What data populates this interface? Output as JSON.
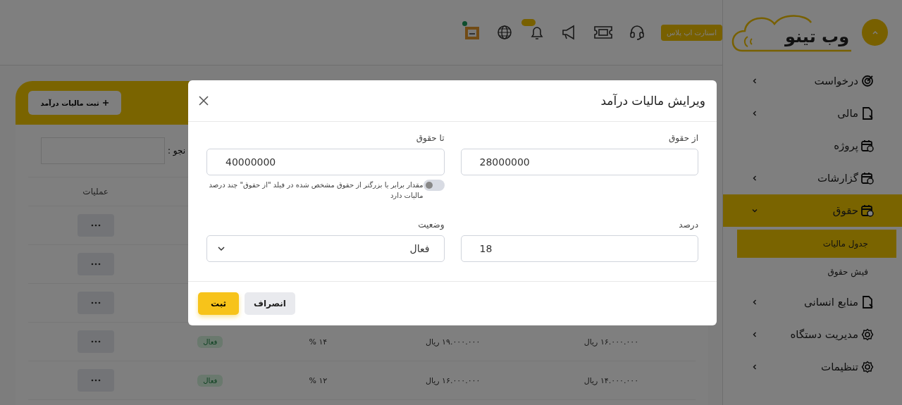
{
  "header": {
    "upgrade_button": "استارت اپ پلاس",
    "notification_badge": true,
    "profile_online": true
  },
  "sidebar": {
    "logo": "وب تینو",
    "items": [
      {
        "label": "درخواست",
        "has_children": true,
        "expanded": false,
        "selected": false
      },
      {
        "label": "مالی",
        "has_children": true,
        "expanded": false,
        "selected": false
      },
      {
        "label": "پروژه",
        "has_children": false,
        "selected": false
      },
      {
        "label": "گزارشات",
        "has_children": true,
        "expanded": false,
        "selected": false
      },
      {
        "label": "حقوق",
        "has_children": true,
        "expanded": true,
        "selected": true,
        "children": [
          {
            "label": "جدول مالیات",
            "selected": true
          },
          {
            "label": "فیش حقوق",
            "selected": false
          }
        ]
      },
      {
        "label": "منابع انسانی",
        "has_children": true,
        "expanded": false,
        "selected": false
      },
      {
        "label": "مدیریت دستگاه",
        "has_children": true,
        "expanded": false,
        "selected": false
      },
      {
        "label": "تنظیمات",
        "has_children": true,
        "expanded": false,
        "selected": false
      }
    ]
  },
  "page": {
    "add_button": "ثبت مالیات درآمد",
    "search_label": "نجو :",
    "table": {
      "columns": [
        "عملیات"
      ],
      "rows": [
        {},
        {},
        {},
        {
          "from_salary": "۱۶.۰۰۰.۰۰۰ ریال",
          "to_salary": "۱۹.۰۰۰.۰۰۰ ریال",
          "percent": "۱۴ %",
          "status": "فعال"
        },
        {
          "from_salary": "۱۴.۰۰۰.۰۰۰ ریال",
          "to_salary": "۱۶.۰۰۰.۰۰۰ ریال",
          "percent": "۱۲ %",
          "status": "فعال"
        }
      ]
    }
  },
  "modal": {
    "title": "ویرایش مالیات درآمد",
    "fields": [
      {
        "label": "از حقوق",
        "value": "28000000",
        "kind": "text"
      },
      {
        "label": "تا حقوق",
        "value": "40000000",
        "kind": "text",
        "toggle": {
          "on": false,
          "help": "مقدار برابر یا بزرگتر از حقوق مشخص شده در فیلد \"از حقوق\" چند درصد مالیات دارد"
        }
      },
      {
        "label": "درصد",
        "value": "18",
        "kind": "text"
      },
      {
        "label": "وضعیت",
        "value": "فعال",
        "kind": "select"
      }
    ],
    "buttons": [
      {
        "label": "انصراف",
        "kind": "secondary"
      },
      {
        "label": "ثبت",
        "kind": "primary"
      }
    ]
  }
}
